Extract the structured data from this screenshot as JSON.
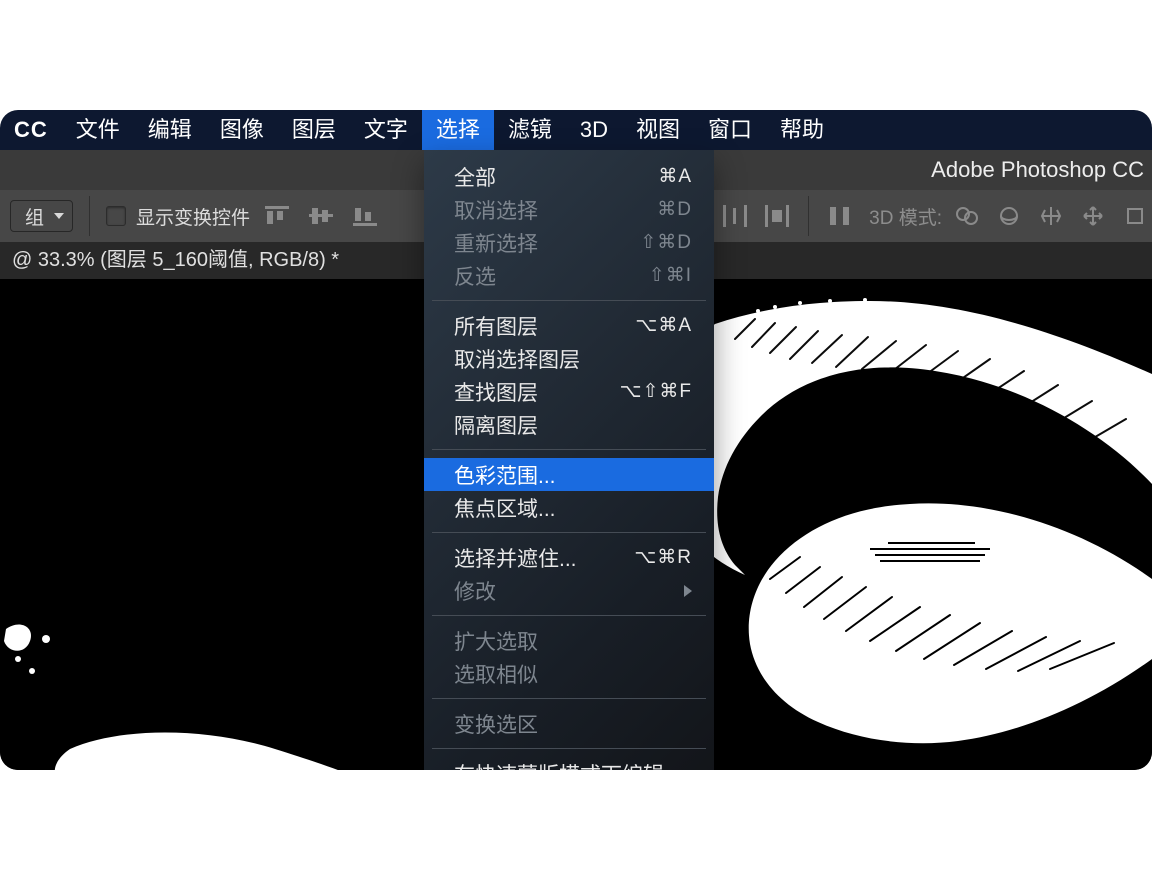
{
  "app_badge": "CC",
  "menubar": {
    "items": [
      "文件",
      "编辑",
      "图像",
      "图层",
      "文字",
      "选择",
      "滤镜",
      "3D",
      "视图",
      "窗口",
      "帮助"
    ],
    "active_index": 5
  },
  "title": "Adobe Photoshop CC",
  "optbar": {
    "group_label": "组",
    "show_transform_controls": "显示变换控件",
    "mode_3d_label": "3D 模式:"
  },
  "doc_tab": "@ 33.3% (图层 5_160阈值, RGB/8) *",
  "dropdown": {
    "groups": [
      [
        {
          "label": "全部",
          "shortcut": "⌘A",
          "disabled": false
        },
        {
          "label": "取消选择",
          "shortcut": "⌘D",
          "disabled": true
        },
        {
          "label": "重新选择",
          "shortcut": "⇧⌘D",
          "disabled": true
        },
        {
          "label": "反选",
          "shortcut": "⇧⌘I",
          "disabled": true
        }
      ],
      [
        {
          "label": "所有图层",
          "shortcut": "⌥⌘A",
          "disabled": false
        },
        {
          "label": "取消选择图层",
          "shortcut": "",
          "disabled": false
        },
        {
          "label": "查找图层",
          "shortcut": "⌥⇧⌘F",
          "disabled": false
        },
        {
          "label": "隔离图层",
          "shortcut": "",
          "disabled": false
        }
      ],
      [
        {
          "label": "色彩范围...",
          "shortcut": "",
          "disabled": false,
          "highlight": true
        },
        {
          "label": "焦点区域...",
          "shortcut": "",
          "disabled": false
        }
      ],
      [
        {
          "label": "选择并遮住...",
          "shortcut": "⌥⌘R",
          "disabled": false
        },
        {
          "label": "修改",
          "shortcut": "",
          "disabled": true,
          "submenu": true
        }
      ],
      [
        {
          "label": "扩大选取",
          "shortcut": "",
          "disabled": true
        },
        {
          "label": "选取相似",
          "shortcut": "",
          "disabled": true
        }
      ],
      [
        {
          "label": "变换选区",
          "shortcut": "",
          "disabled": true
        }
      ],
      [
        {
          "label": "在快速蒙版模式下编辑",
          "shortcut": "",
          "disabled": false
        }
      ]
    ]
  }
}
